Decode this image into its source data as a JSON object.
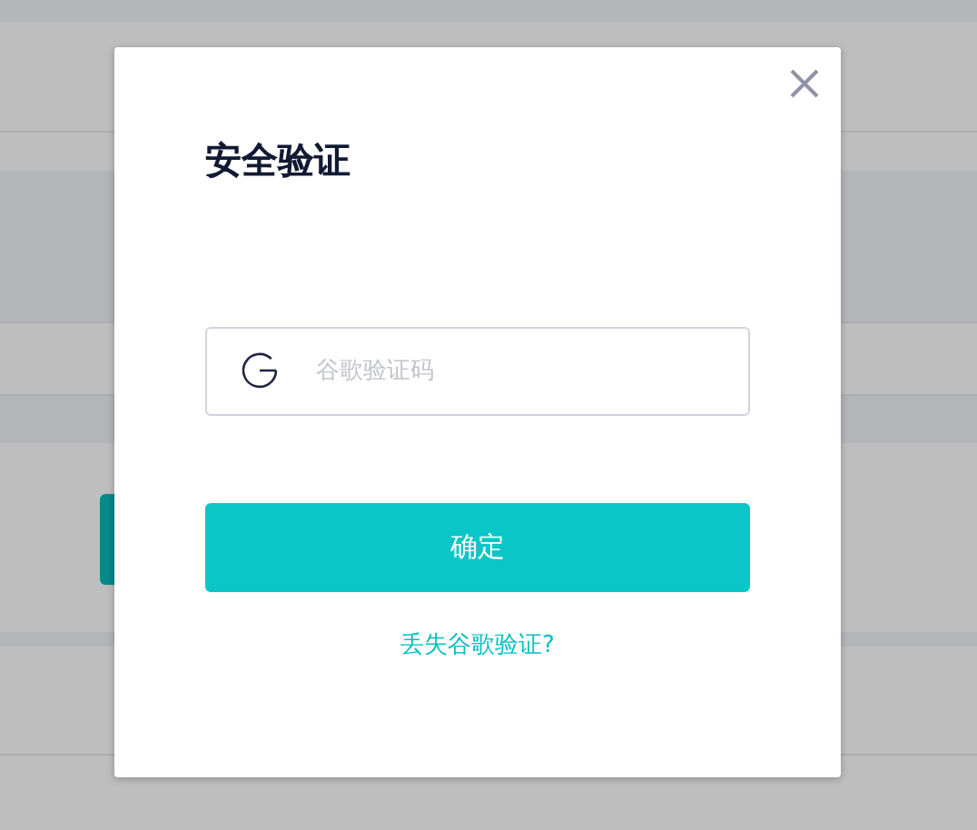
{
  "dialog": {
    "title": "安全验证",
    "code_field": {
      "placeholder": "谷歌验证码"
    },
    "confirm_button": "确定",
    "lost_link": "丢失谷歌验证?"
  }
}
